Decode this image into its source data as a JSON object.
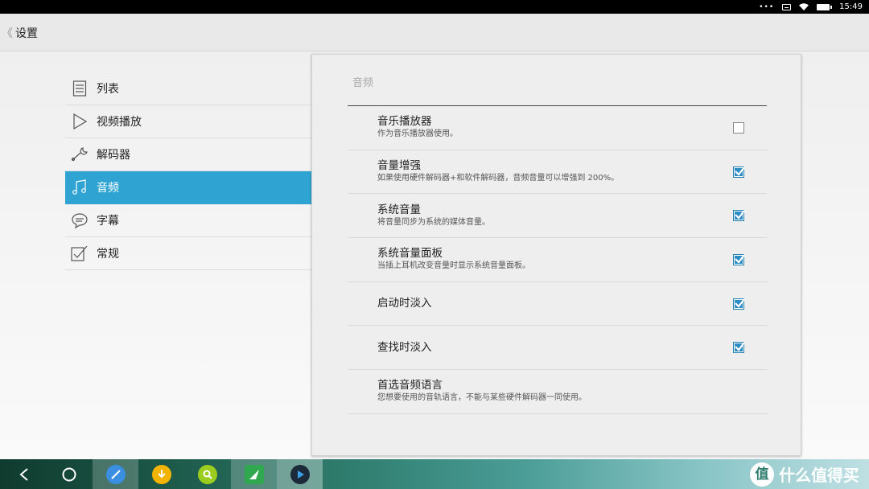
{
  "status_bar": {
    "menu_dots": "•••",
    "time": "15:49"
  },
  "header": {
    "back_chevron": "《",
    "title": "设置"
  },
  "menu": {
    "items": [
      {
        "label": "列表",
        "icon": "list-icon",
        "active": false
      },
      {
        "label": "视频播放",
        "icon": "play-icon",
        "active": false
      },
      {
        "label": "解码器",
        "icon": "wrench-icon",
        "active": false
      },
      {
        "label": "音频",
        "icon": "music-note-icon",
        "active": true
      },
      {
        "label": "字幕",
        "icon": "speech-bubble-icon",
        "active": false
      },
      {
        "label": "常规",
        "icon": "checklist-icon",
        "active": false
      }
    ]
  },
  "panel": {
    "title": "音频",
    "settings": [
      {
        "title": "音乐播放器",
        "desc": "作为音乐播放器使用。",
        "checkbox": true,
        "checked": false
      },
      {
        "title": "音量增强",
        "desc": "如果使用硬件解码器+和软件解码器，音频音量可以增强到 200%。",
        "checkbox": true,
        "checked": true
      },
      {
        "title": "系统音量",
        "desc": "将音量同步为系统的媒体音量。",
        "checkbox": true,
        "checked": true
      },
      {
        "title": "系统音量面板",
        "desc": "当插上耳机改变音量时显示系统音量面板。",
        "checkbox": true,
        "checked": true
      },
      {
        "title": "启动时淡入",
        "desc": "",
        "checkbox": true,
        "checked": true
      },
      {
        "title": "查找时淡入",
        "desc": "",
        "checkbox": true,
        "checked": true
      },
      {
        "title": "首选音频语言",
        "desc": "您想要使用的音轨语言，不能与某些硬件解码器一同使用。",
        "checkbox": false,
        "checked": false
      }
    ]
  },
  "taskbar": {
    "apps": [
      {
        "icon": "browser-icon",
        "color": "#3a8fe0"
      },
      {
        "icon": "download-icon",
        "color": "#f2b400"
      },
      {
        "icon": "search-app-icon",
        "color": "#9acd1e"
      },
      {
        "icon": "bird-app-icon",
        "color": "#2fa84f"
      },
      {
        "icon": "media-player-icon",
        "color": "#1d2a3a"
      }
    ],
    "watermark_text": "什么值得买"
  },
  "colors": {
    "accent": "#2fa4d2",
    "checkbox": "#2d8cc4"
  }
}
